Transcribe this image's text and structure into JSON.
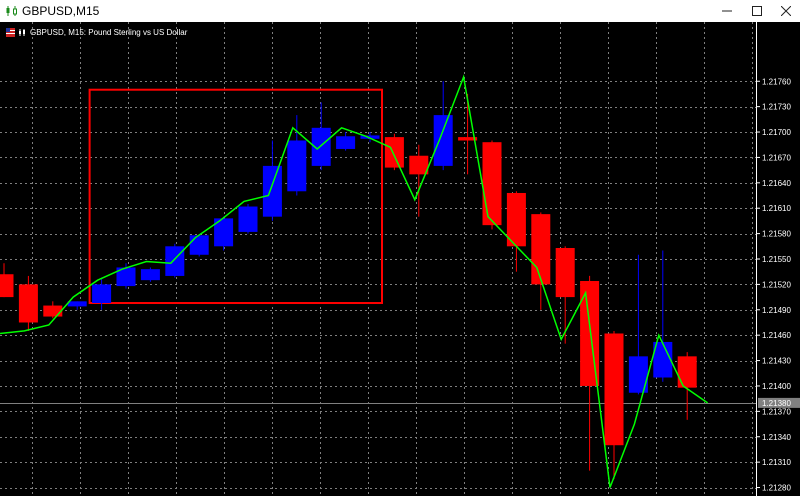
{
  "window": {
    "title": "GBPUSD,M15",
    "min_icon": "minimize-icon",
    "max_icon": "maximize-icon",
    "close_icon": "close-icon"
  },
  "chart_header": {
    "text": "GBPUSD, M15:  Pound Sterling vs US Dollar"
  },
  "colors": {
    "background": "#000000",
    "grid": "#7f7f7f",
    "bull": "#0000ff",
    "bear": "#ff0000",
    "ma_line": "#00ff00",
    "box": "#ff0000",
    "axis_text": "#ffffff",
    "bid_line": "#808080",
    "bid_label_bg": "#808080"
  },
  "chart_data": {
    "type": "candlestick",
    "symbol": "GBPUSD",
    "timeframe": "M15",
    "ylim": [
      1.2127,
      1.2183
    ],
    "yticks": [
      "1.21760",
      "1.21730",
      "1.21700",
      "1.21670",
      "1.21640",
      "1.21610",
      "1.21580",
      "1.21550",
      "1.21520",
      "1.21490",
      "1.21460",
      "1.21430",
      "1.21400",
      "1.21370",
      "1.21340",
      "1.21310",
      "1.21280"
    ],
    "current_price": "1.21380",
    "candles": [
      {
        "o": 1.21532,
        "h": 1.21545,
        "l": 1.21505,
        "c": 1.21505
      },
      {
        "o": 1.2152,
        "h": 1.2153,
        "l": 1.21465,
        "c": 1.21475
      },
      {
        "o": 1.21495,
        "h": 1.215,
        "l": 1.2148,
        "c": 1.21482
      },
      {
        "o": 1.21494,
        "h": 1.215,
        "l": 1.2149,
        "c": 1.215
      },
      {
        "o": 1.21498,
        "h": 1.21528,
        "l": 1.2149,
        "c": 1.2152
      },
      {
        "o": 1.21518,
        "h": 1.21545,
        "l": 1.21515,
        "c": 1.2154
      },
      {
        "o": 1.21525,
        "h": 1.2154,
        "l": 1.21523,
        "c": 1.21538
      },
      {
        "o": 1.2153,
        "h": 1.21568,
        "l": 1.21528,
        "c": 1.21565
      },
      {
        "o": 1.21555,
        "h": 1.21578,
        "l": 1.21553,
        "c": 1.21578
      },
      {
        "o": 1.21565,
        "h": 1.216,
        "l": 1.2156,
        "c": 1.21598
      },
      {
        "o": 1.21582,
        "h": 1.21615,
        "l": 1.2158,
        "c": 1.21612
      },
      {
        "o": 1.216,
        "h": 1.2169,
        "l": 1.21595,
        "c": 1.2166
      },
      {
        "o": 1.2163,
        "h": 1.2172,
        "l": 1.21625,
        "c": 1.2169
      },
      {
        "o": 1.2166,
        "h": 1.21735,
        "l": 1.21655,
        "c": 1.21705
      },
      {
        "o": 1.2168,
        "h": 1.217,
        "l": 1.21678,
        "c": 1.21695
      },
      {
        "o": 1.21692,
        "h": 1.217,
        "l": 1.21688,
        "c": 1.21696
      },
      {
        "o": 1.21694,
        "h": 1.21698,
        "l": 1.21655,
        "c": 1.21658
      },
      {
        "o": 1.21672,
        "h": 1.21685,
        "l": 1.216,
        "c": 1.2165
      },
      {
        "o": 1.2166,
        "h": 1.2176,
        "l": 1.21655,
        "c": 1.2172
      },
      {
        "o": 1.21694,
        "h": 1.21745,
        "l": 1.2165,
        "c": 1.2169
      },
      {
        "o": 1.21688,
        "h": 1.2169,
        "l": 1.21585,
        "c": 1.2159
      },
      {
        "o": 1.21628,
        "h": 1.2163,
        "l": 1.21535,
        "c": 1.21565
      },
      {
        "o": 1.21603,
        "h": 1.21605,
        "l": 1.2149,
        "c": 1.2152
      },
      {
        "o": 1.21563,
        "h": 1.21565,
        "l": 1.2145,
        "c": 1.21505
      },
      {
        "o": 1.21524,
        "h": 1.2153,
        "l": 1.213,
        "c": 1.214
      },
      {
        "o": 1.21462,
        "h": 1.21465,
        "l": 1.2129,
        "c": 1.2133
      },
      {
        "o": 1.21392,
        "h": 1.21555,
        "l": 1.2139,
        "c": 1.21435
      },
      {
        "o": 1.2141,
        "h": 1.2156,
        "l": 1.21405,
        "c": 1.21452
      },
      {
        "o": 1.21435,
        "h": 1.2144,
        "l": 1.2136,
        "c": 1.21398
      }
    ],
    "ma": [
      1.21462,
      1.21465,
      1.21472,
      1.21505,
      1.21525,
      1.21538,
      1.21547,
      1.21545,
      1.21575,
      1.21595,
      1.21618,
      1.21625,
      1.21705,
      1.2168,
      1.21705,
      1.21695,
      1.21682,
      1.2162,
      1.2169,
      1.21765,
      1.216,
      1.2157,
      1.2154,
      1.21455,
      1.2151,
      1.2128,
      1.21355,
      1.2146,
      1.214,
      1.2138
    ],
    "annotations": [
      {
        "type": "rectangle",
        "from_bar": 4,
        "to_bar": 15,
        "price_top": 1.2175,
        "price_bottom": 1.21498
      }
    ]
  }
}
